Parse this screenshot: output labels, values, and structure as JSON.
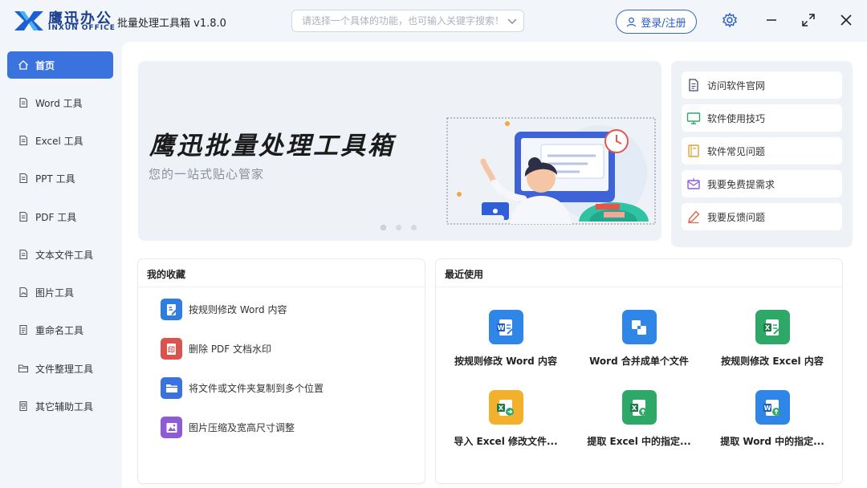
{
  "brand": {
    "name_cn": "鹰迅办公",
    "name_en": "INXUN OFFICE"
  },
  "app_title": "批量处理工具箱 v1.8.0",
  "search": {
    "placeholder": "请选择一个具体的功能，也可输入关键字搜索！"
  },
  "login_label": "登录/注册",
  "sidebar": {
    "items": [
      {
        "label": "首页",
        "icon": "home-icon",
        "active": true
      },
      {
        "label": "Word 工具",
        "icon": "document-icon"
      },
      {
        "label": "Excel 工具",
        "icon": "document-icon"
      },
      {
        "label": "PPT 工具",
        "icon": "document-icon"
      },
      {
        "label": "PDF 工具",
        "icon": "document-icon"
      },
      {
        "label": "文本文件工具",
        "icon": "document-icon"
      },
      {
        "label": "图片工具",
        "icon": "image-icon"
      },
      {
        "label": "重命名工具",
        "icon": "rename-icon"
      },
      {
        "label": "文件整理工具",
        "icon": "folder-icon"
      },
      {
        "label": "其它辅助工具",
        "icon": "tools-icon"
      }
    ]
  },
  "banner": {
    "title": "鹰迅批量处理工具箱",
    "subtitle": "您的一站式贴心管家",
    "slides": 3,
    "active_slide": 0
  },
  "quick_links": [
    {
      "label": "访问软件官网",
      "icon": "document-icon"
    },
    {
      "label": "软件使用技巧",
      "icon": "monitor-icon"
    },
    {
      "label": "软件常见问题",
      "icon": "book-icon"
    },
    {
      "label": "我要免费提需求",
      "icon": "mail-icon"
    },
    {
      "label": "我要反馈问题",
      "icon": "pen-icon"
    }
  ],
  "favorites": {
    "title": "我的收藏",
    "items": [
      {
        "label": "按规则修改 Word 内容",
        "icon": "word-edit-icon",
        "color": "#2f7de1"
      },
      {
        "label": "删除 PDF 文档水印",
        "icon": "pdf-watermark-icon",
        "color": "#d9534f"
      },
      {
        "label": "将文件或文件夹复制到多个位置",
        "icon": "folder-copy-icon",
        "color": "#3a73dd"
      },
      {
        "label": "图片压缩及宽高尺寸调整",
        "icon": "image-resize-icon",
        "color": "#8e5bd8"
      }
    ]
  },
  "recent": {
    "title": "最近使用",
    "items": [
      {
        "label": "按规则修改 Word 内容",
        "icon": "word-edit-icon",
        "color": "#2f86e6"
      },
      {
        "label": "Word 合并成单个文件",
        "icon": "merge-icon",
        "color": "#2f86e6"
      },
      {
        "label": "按规则修改 Excel 内容",
        "icon": "excel-edit-icon",
        "color": "#2ea866"
      },
      {
        "label": "导入 Excel 修改文件...",
        "icon": "excel-import-icon",
        "color": "#f2b12c"
      },
      {
        "label": "提取 Excel 中的指定...",
        "icon": "excel-extract-icon",
        "color": "#2ea866"
      },
      {
        "label": "提取 Word 中的指定...",
        "icon": "word-extract-icon",
        "color": "#2f86e6"
      }
    ]
  }
}
